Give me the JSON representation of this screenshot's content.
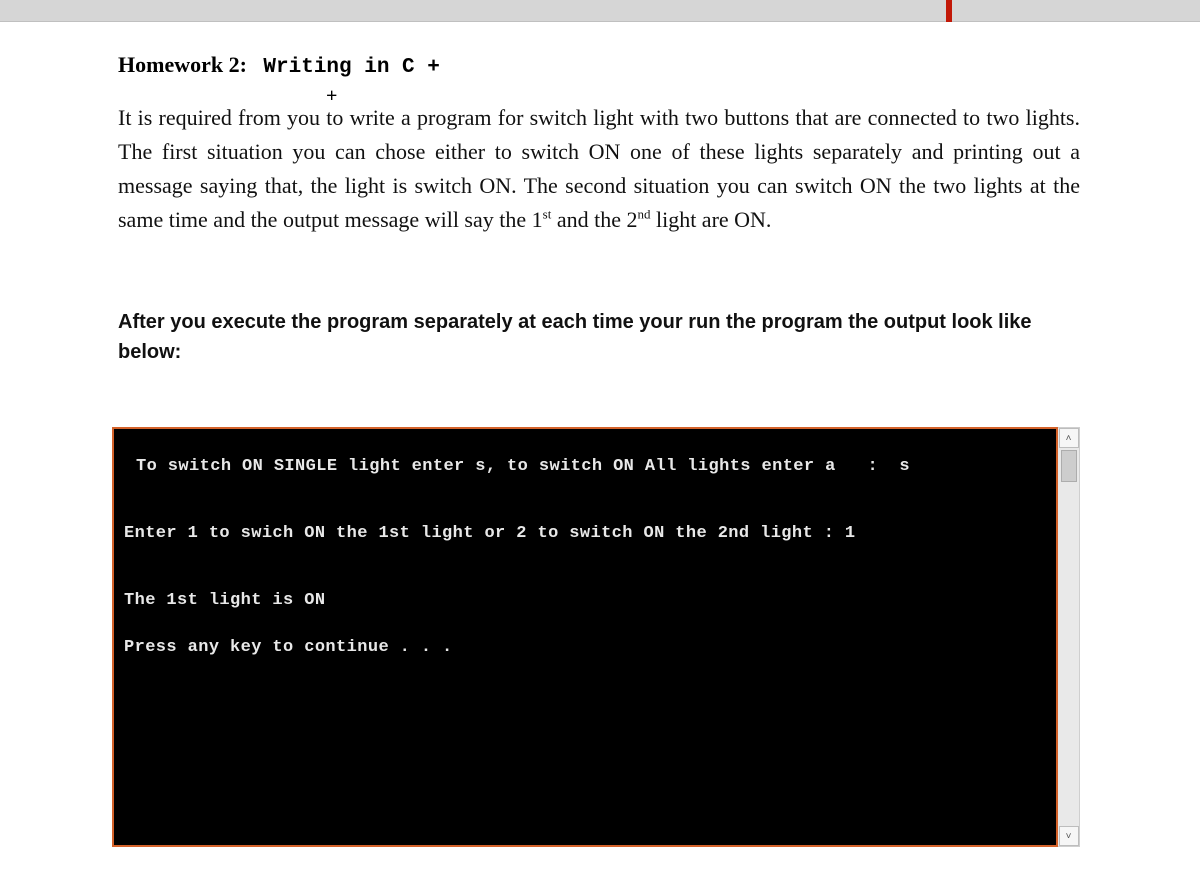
{
  "header": {
    "title_prefix": "Homework 2:",
    "title_mono": "Writing in C +",
    "extra_plus": "+"
  },
  "body": {
    "paragraph_html": "It is required from you to write a program for switch light with two buttons that are connected to two lights. The first situation you can chose either to switch ON one of these lights separately and printing out a message saying that, the light is switch ON. The second situation you can switch ON the two lights at the same time and the output message will say the 1<span class=\"sup\">st</span> and the 2<span class=\"sup\">nd</span> light are ON."
  },
  "instruction": "After you execute the program separately at each time your run the program the output look like below:",
  "console": {
    "line1": "To switch ON SINGLE light enter s, to switch ON All lights enter a   :  s",
    "line2": "Enter 1 to swich ON the 1st light or 2 to switch ON the 2nd light : 1",
    "line3": "The 1st light is ON",
    "line4": "Press any key to continue . . ."
  },
  "scrollbar": {
    "up_glyph": "˄",
    "down_glyph": "˅"
  }
}
